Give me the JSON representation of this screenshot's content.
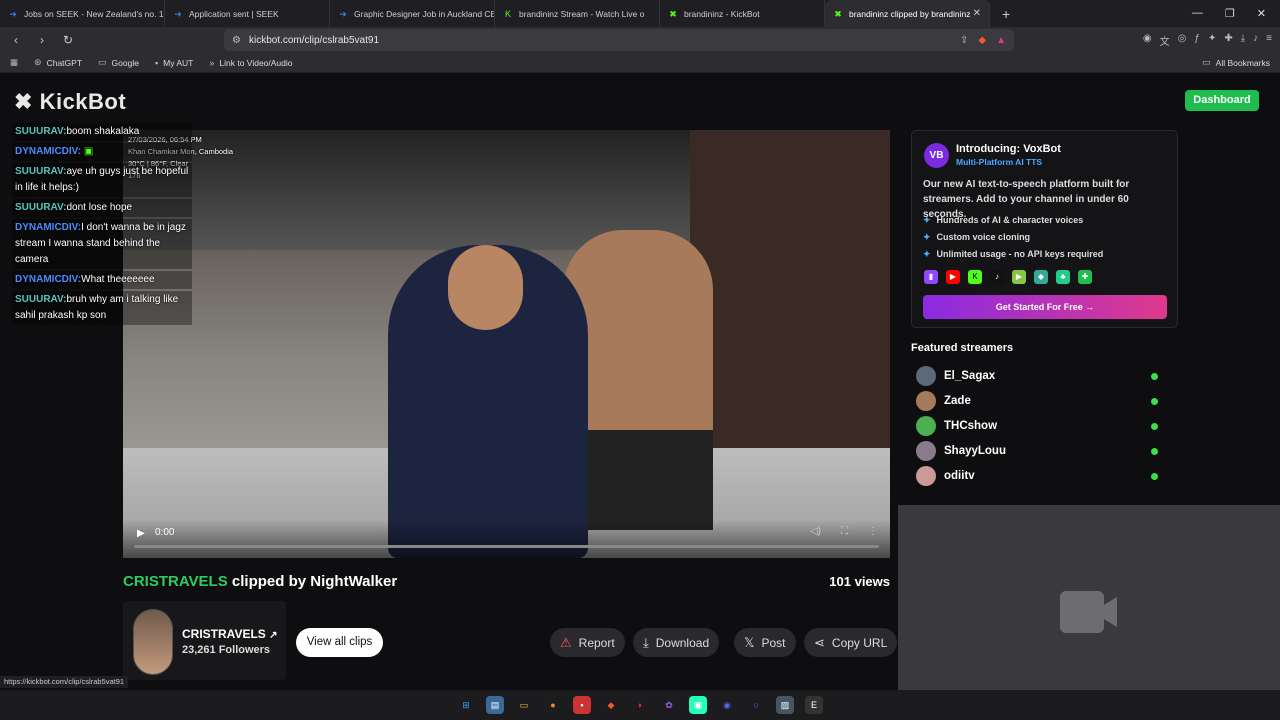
{
  "browser": {
    "tabs": [
      {
        "label": "Jobs on SEEK - New Zealand's no. 1 E",
        "icon": "seek-icon",
        "active": false
      },
      {
        "label": "Application sent | SEEK",
        "icon": "seek-icon",
        "active": false
      },
      {
        "label": "Graphic Designer Job in Auckland CE",
        "icon": "seek-icon",
        "active": false
      },
      {
        "label": "brandininz Stream - Watch Live o",
        "icon": "kick-icon",
        "active": false
      },
      {
        "label": "brandininz - KickBot",
        "icon": "kickbot-icon",
        "active": false
      },
      {
        "label": "brandininz clipped by brandininz",
        "icon": "kickbot-icon",
        "active": true
      }
    ],
    "url": "kickbot.com/clip/cslrab5vat91",
    "bookmarks": [
      "ChatGPT",
      "Google",
      "My AUT",
      "Link to Video/Audio"
    ],
    "all_bookmarks": "All Bookmarks",
    "status_url": "https://kickbot.com/clip/cslrab5vat91"
  },
  "site": {
    "logo": "KickBot",
    "dashboard": "Dashboard"
  },
  "video": {
    "overlay_lines": [
      "27/03/2026, 06:54 PM",
      "Khan Chamkar Mon, Cambodia",
      "30°C | 86°F, Clear",
      "176"
    ],
    "time": "0:00"
  },
  "chat": [
    {
      "user": "SUUURAV:",
      "text": "boom shakalaka",
      "color": "#58c7c0"
    },
    {
      "user": "DYNAMICDIV:",
      "text": "",
      "color": "#4b8cff"
    },
    {
      "user": "SUUURAV:",
      "text": "aye uh guys just be hopeful in life it helps:)",
      "color": "#58c7c0"
    },
    {
      "user": "SUUURAV:",
      "text": "dont lose hope",
      "color": "#58c7c0"
    },
    {
      "user": "DYNAMICDIV:",
      "text": "I don't wanna be in jagz stream I wanna stand behind the camera",
      "color": "#4b8cff"
    },
    {
      "user": "DYNAMICDIV:",
      "text": "What theeeeeee",
      "color": "#4b8cff"
    },
    {
      "user": "SUUURAV:",
      "text": "bruh why am i talking like sahil prakash kp son",
      "color": "#58c7c0"
    }
  ],
  "clip": {
    "streamer": "CRISTRAVELS",
    "clipped_by": " clipped by NightWalker",
    "views": "101 views",
    "creator_name": "CRISTRAVELS",
    "followers": "23,261 Followers",
    "view_all": "View all clips",
    "report": "Report",
    "download": "Download",
    "post": "Post",
    "copy_url": "Copy URL"
  },
  "promo": {
    "title": "Introducing: VoxBot",
    "subtitle": "Multi-Platform AI TTS",
    "description": "Our new AI text-to-speech platform built for streamers. Add to your channel in under 60 seconds.",
    "features": [
      "Hundreds of AI & character voices",
      "Custom voice cloning",
      "Unlimited usage - no API keys required"
    ],
    "cta": "Get Started For Free →"
  },
  "featured": {
    "heading": "Featured streamers",
    "streamers": [
      "El_Sagax",
      "Zade",
      "THCshow",
      "ShayyLouu",
      "odiitv"
    ]
  },
  "colors": {
    "accent": "#1fbd4f",
    "streamer_name": "#2ecc60",
    "online": "#3ae04a"
  }
}
